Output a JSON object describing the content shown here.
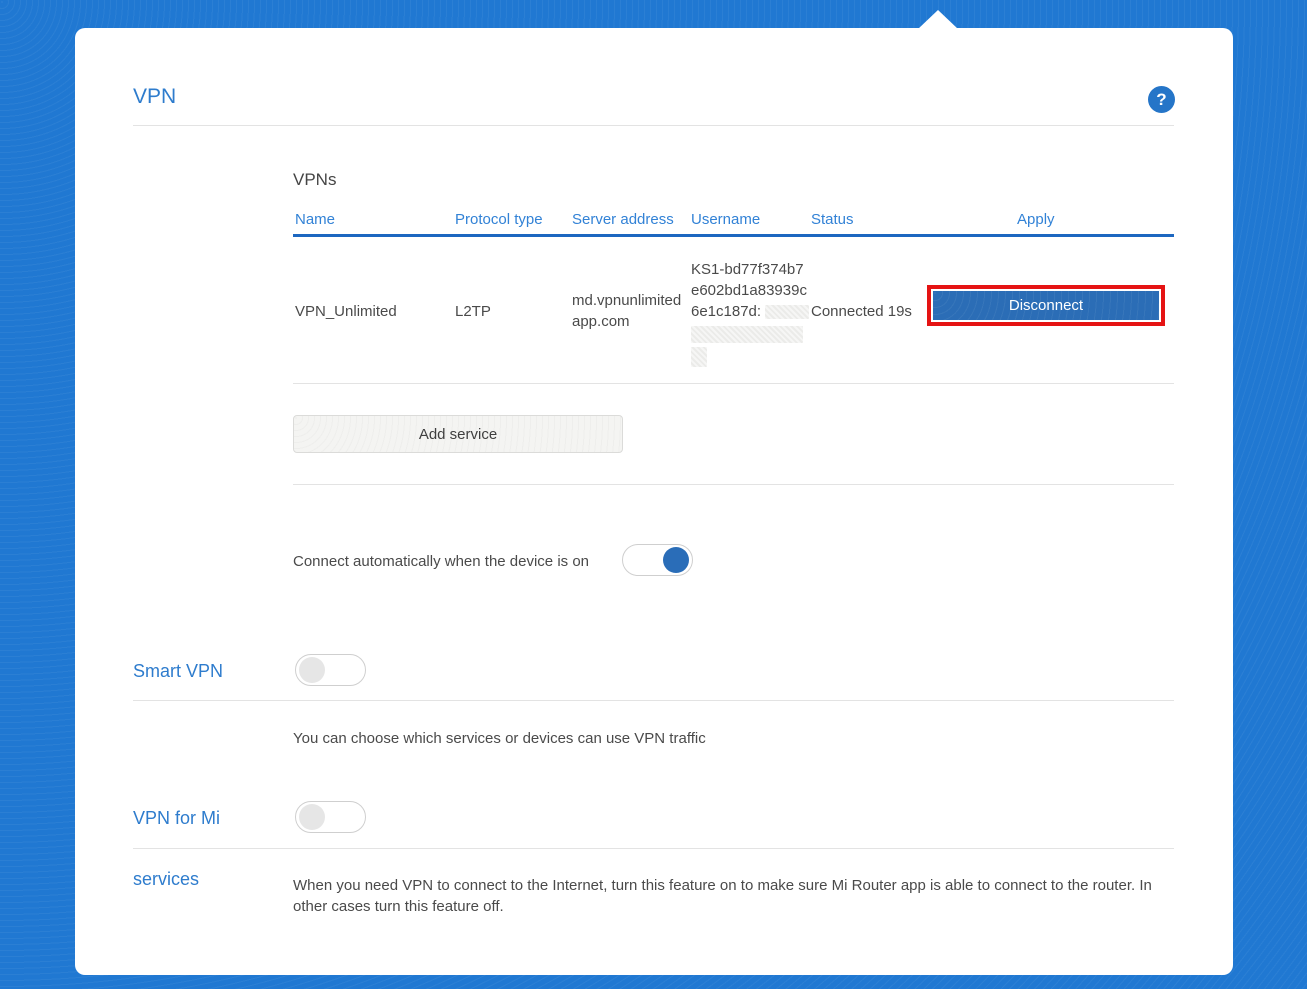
{
  "page": {
    "title": "VPN",
    "help_icon_glyph": "?"
  },
  "vpns": {
    "section_title": "VPNs",
    "columns": [
      "Name",
      "Protocol type",
      "Server address",
      "Username",
      "Status",
      "Apply"
    ],
    "row": {
      "name": "VPN_Unlimited",
      "protocol_type": "L2TP",
      "server_address_line1": "md.vpnunlimited",
      "server_address_line2": "app.com",
      "username_line1": "KS1-bd77f374b7",
      "username_line2": "e602bd1a83939c",
      "username_line3_prefix": "6e1c187d:",
      "username_redacted": true,
      "status": "Connected 19s",
      "apply_button_label": "Disconnect"
    },
    "add_service_button_label": "Add service"
  },
  "auto_connect": {
    "label": "Connect automatically when the device is on",
    "enabled": true
  },
  "smart_vpn": {
    "label": "Smart VPN",
    "enabled": false,
    "description": "You can choose which services or devices can use VPN traffic"
  },
  "vpn_for_mi": {
    "label_line1": "VPN for Mi",
    "label_line2": "services",
    "enabled": false,
    "description": "When you need VPN to connect to the Internet, turn this feature on to make sure Mi Router app is able to connect to the router. In other cases turn this feature off."
  },
  "colors": {
    "background_blue": "#2078d2",
    "accent_blue": "#2e7ccd",
    "table_underline_blue": "#1d67c0",
    "disconnect_button_blue": "#2b6db6",
    "annotation_red": "#e51313",
    "toggle_on_blue": "#2a6db8"
  }
}
